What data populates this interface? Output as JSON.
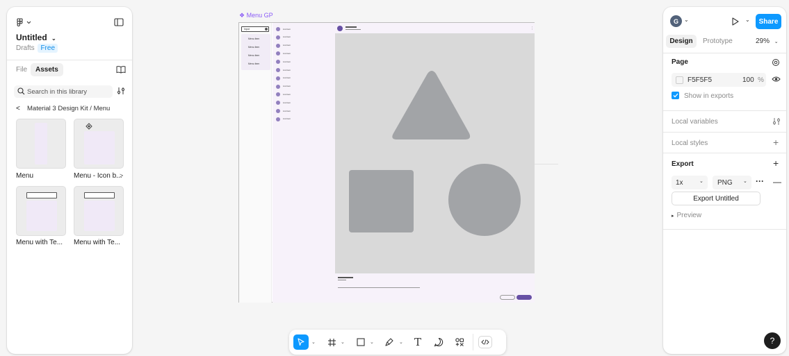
{
  "left_panel": {
    "file_name": "Untitled",
    "location": "Drafts",
    "plan_badge": "Free",
    "tabs": [
      {
        "label": "File"
      },
      {
        "label": "Assets"
      }
    ],
    "search_placeholder": "Search in this library",
    "breadcrumb": {
      "back": "<",
      "path": "Material 3 Design Kit / Menu"
    },
    "assets": [
      {
        "label": "Menu"
      },
      {
        "label": "Menu - Icon b..."
      },
      {
        "label": "Menu with Te..."
      },
      {
        "label": "Menu with Te..."
      }
    ],
    "more_arrow": ">"
  },
  "canvas": {
    "frame_label": "Menu GP",
    "menu_search_text": "Input",
    "menu_items": [
      "Menu item",
      "Menu item",
      "Menu item",
      "Menu item"
    ],
    "list_item_label": "List item",
    "list_item_count": 12
  },
  "right_panel": {
    "avatar_initial": "G",
    "share_label": "Share",
    "tabs": [
      {
        "label": "Design"
      },
      {
        "label": "Prototype"
      }
    ],
    "zoom": "29%",
    "page": {
      "title": "Page",
      "fill_hex": "F5F5F5",
      "opacity": "100",
      "opacity_unit": "%",
      "show_in_exports_label": "Show in exports"
    },
    "local_variables_label": "Local variables",
    "local_styles_label": "Local styles",
    "export": {
      "title": "Export",
      "scale": "1x",
      "format": "PNG",
      "button_label": "Export Untitled",
      "preview_label": "Preview"
    },
    "help_label": "?"
  },
  "toolbar": {
    "tools": [
      "move",
      "frame",
      "shape",
      "pen",
      "text",
      "comment",
      "actions",
      "dev-mode"
    ],
    "text_tool_glyph": "T"
  },
  "colors": {
    "accent": "#0d99ff",
    "selected_tool": "#0d99ff",
    "menu_surface": "#f3edf7",
    "shape_fill": "#a2a4a7",
    "canvas_area": "#d9d9d9"
  }
}
